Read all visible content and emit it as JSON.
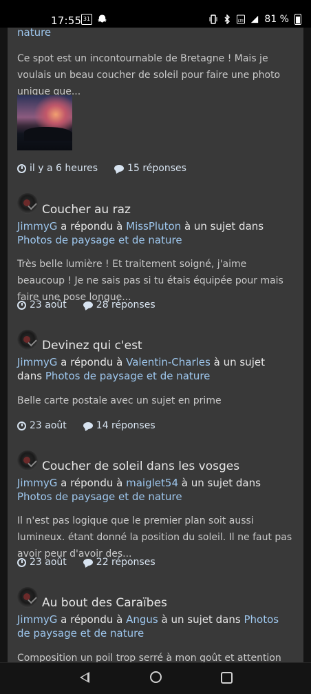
{
  "status": {
    "time": "17:55",
    "calendar_day": "31",
    "battery": "81 %"
  },
  "first_post": {
    "category_tail": "nature",
    "excerpt": "Ce spot est un incontournable de Bretagne ! Mais je voulais un beau coucher de soleil pour faire une photo unique que...",
    "time": "il y a 6 heures",
    "replies": "15 réponses"
  },
  "topics": [
    {
      "title": "Coucher au raz",
      "user": "JimmyG",
      "verb": "a répondu à",
      "target": "MissPluton",
      "in": "à un sujet dans",
      "category": "Photos de paysage et de nature",
      "excerpt": "Très belle lumière ! Et traitement soigné, j'aime beaucoup ! Je ne sais pas si tu étais équipée pour mais faire une pose longue...",
      "time": "23 août",
      "replies": "28 réponses"
    },
    {
      "title": "Devinez qui c'est",
      "user": "JimmyG",
      "verb": "a répondu à",
      "target": "Valentin-Charles",
      "in": "à un sujet dans",
      "category": "Photos de paysage et de nature",
      "excerpt": "Belle carte postale avec un sujet en prime",
      "time": "23 août",
      "replies": "14 réponses"
    },
    {
      "title": "Coucher de soleil dans les vosges",
      "user": "JimmyG",
      "verb": "a répondu à",
      "target": "maiglet54",
      "in": "à un sujet dans",
      "category": "Photos de paysage et de nature",
      "excerpt": "Il n'est pas logique que le premier plan soit aussi lumineux. étant donné la position du soleil. Il ne faut pas avoir peur d'avoir des...",
      "time": "23 août",
      "replies": "22 réponses"
    },
    {
      "title": "Au bout des Caraïbes",
      "user": "JimmyG",
      "verb": "a répondu à",
      "target": "Angus",
      "in": "à un sujet dans",
      "category": "Photos de paysage et de nature",
      "excerpt": "Composition un poil trop serré à mon goût et attention aux"
    }
  ]
}
